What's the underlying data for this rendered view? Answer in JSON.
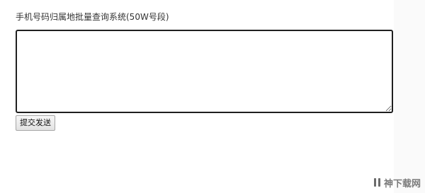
{
  "page": {
    "title": "手机号码归属地批量查询系统(50W号段)"
  },
  "form": {
    "textarea_value": "",
    "submit_label": "提交发送"
  },
  "watermark": {
    "text": "神下载网"
  }
}
